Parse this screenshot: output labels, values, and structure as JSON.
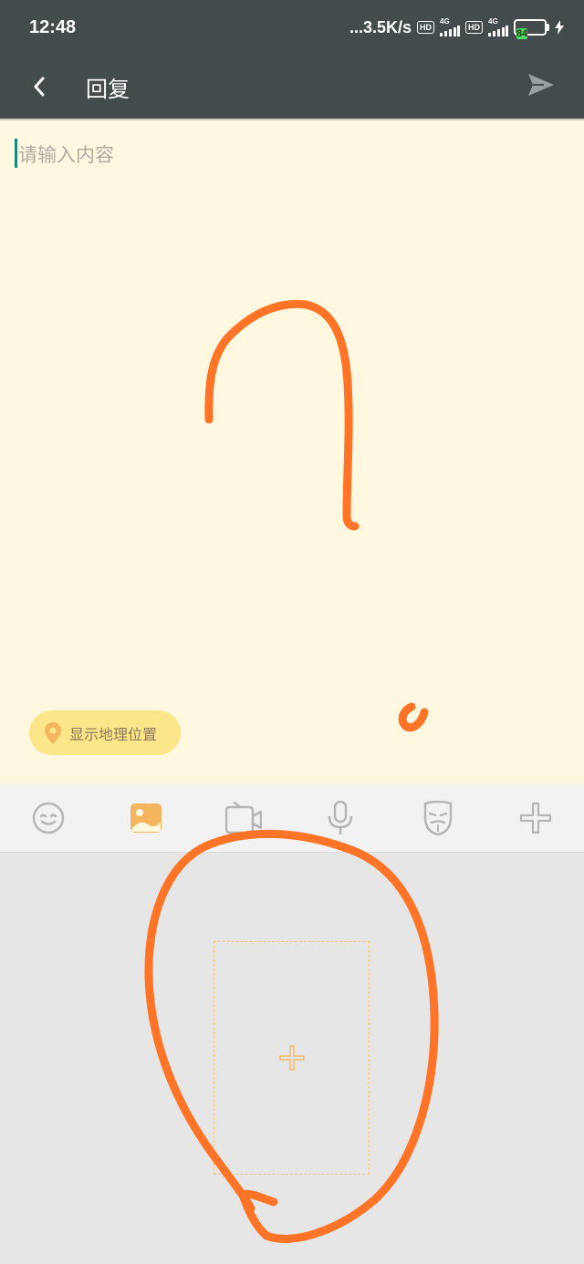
{
  "status_bar": {
    "time": "12:48",
    "net_speed": "...3.5K/s",
    "hd_badge": "HD",
    "signal_gen": "4G",
    "battery": "84"
  },
  "app_bar": {
    "title": "回复"
  },
  "editor": {
    "placeholder": "请输入内容"
  },
  "location_chip": {
    "label": "显示地理位置"
  },
  "toolbar": {
    "items": [
      "emoji-icon",
      "image-icon",
      "video-icon",
      "microphone-icon",
      "mask-icon",
      "plus-icon"
    ],
    "active_item": "image-icon"
  },
  "colors": {
    "header_bg": "#434b4d",
    "editor_bg": "#fff8e1",
    "accent_orange": "#f5b55f",
    "annotation_orange": "#ff7427",
    "chip_bg": "#fde68a"
  }
}
